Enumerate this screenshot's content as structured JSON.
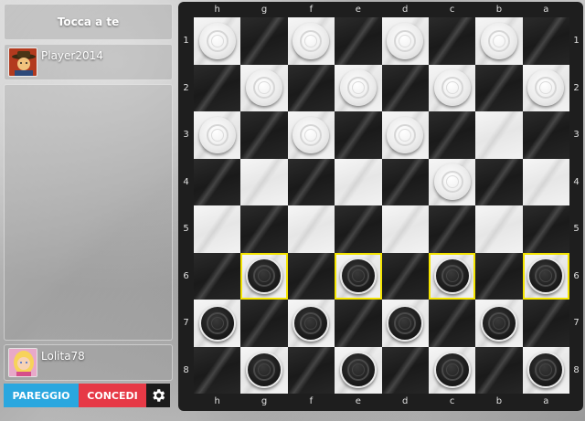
{
  "sidebar": {
    "turn_label": "Tocca a te",
    "top_player": {
      "name": "Player2014",
      "avatar": "cowboy-avatar"
    },
    "bottom_player": {
      "name": "Lolita78",
      "avatar": "blonde-girl-avatar"
    },
    "buttons": {
      "draw_label": "PAREGGIO",
      "resign_label": "CONCEDI",
      "settings_icon": "gear-icon"
    }
  },
  "board": {
    "files": [
      "h",
      "g",
      "f",
      "e",
      "d",
      "c",
      "b",
      "a"
    ],
    "ranks": [
      "1",
      "2",
      "3",
      "4",
      "5",
      "6",
      "7",
      "8"
    ],
    "dark_squares_when_sum_even": false,
    "highlighted": [
      [
        5,
        1
      ],
      [
        5,
        3
      ],
      [
        5,
        5
      ],
      [
        5,
        7
      ]
    ],
    "pieces": [
      {
        "row": 0,
        "col": 0,
        "color": "white"
      },
      {
        "row": 0,
        "col": 2,
        "color": "white"
      },
      {
        "row": 0,
        "col": 4,
        "color": "white"
      },
      {
        "row": 0,
        "col": 6,
        "color": "white"
      },
      {
        "row": 1,
        "col": 1,
        "color": "white"
      },
      {
        "row": 1,
        "col": 3,
        "color": "white"
      },
      {
        "row": 1,
        "col": 5,
        "color": "white"
      },
      {
        "row": 1,
        "col": 7,
        "color": "white"
      },
      {
        "row": 2,
        "col": 0,
        "color": "white"
      },
      {
        "row": 2,
        "col": 2,
        "color": "white"
      },
      {
        "row": 2,
        "col": 4,
        "color": "white"
      },
      {
        "row": 3,
        "col": 5,
        "color": "white"
      },
      {
        "row": 5,
        "col": 1,
        "color": "black"
      },
      {
        "row": 5,
        "col": 3,
        "color": "black"
      },
      {
        "row": 5,
        "col": 5,
        "color": "black"
      },
      {
        "row": 5,
        "col": 7,
        "color": "black"
      },
      {
        "row": 6,
        "col": 0,
        "color": "black"
      },
      {
        "row": 6,
        "col": 2,
        "color": "black"
      },
      {
        "row": 6,
        "col": 4,
        "color": "black"
      },
      {
        "row": 6,
        "col": 6,
        "color": "black"
      },
      {
        "row": 7,
        "col": 1,
        "color": "black"
      },
      {
        "row": 7,
        "col": 3,
        "color": "black"
      },
      {
        "row": 7,
        "col": 5,
        "color": "black"
      },
      {
        "row": 7,
        "col": 7,
        "color": "black"
      }
    ],
    "colors": {
      "highlight": "#f4e400",
      "frame": "#1e1e1e"
    }
  }
}
